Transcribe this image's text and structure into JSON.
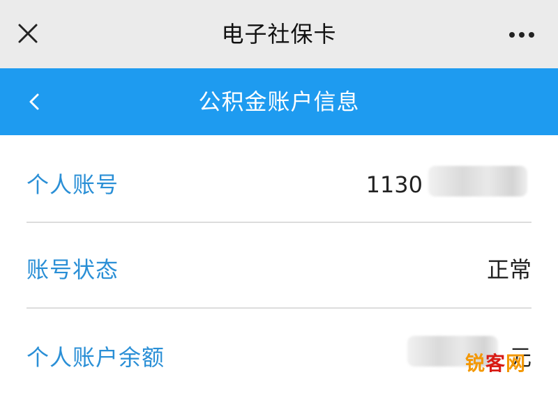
{
  "app_header": {
    "title": "电子社保卡",
    "close_icon": "close-icon",
    "more_icon": "more-horizontal-icon"
  },
  "page_header": {
    "title": "公积金账户信息",
    "back_icon": "chevron-left-icon",
    "background_color": "#1E9BF0"
  },
  "account_info": {
    "rows": [
      {
        "label": "个人账号",
        "value": "1130"
      },
      {
        "label": "账号状态",
        "value": "正常"
      },
      {
        "label": "个人账户余额",
        "value": "元"
      }
    ],
    "label_color": "#2A8FD6"
  },
  "watermark": {
    "part1": "锐",
    "part2": "客",
    "part3": "网"
  }
}
